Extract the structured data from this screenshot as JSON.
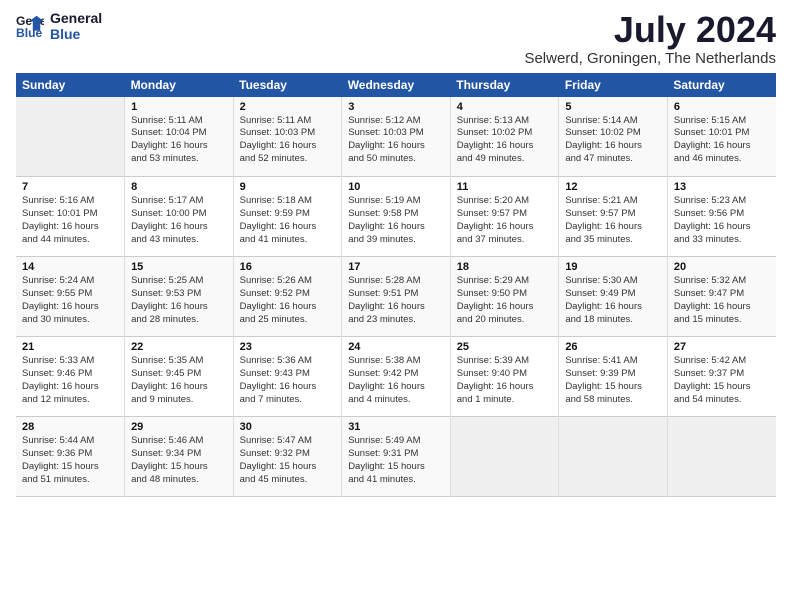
{
  "logo": {
    "line1": "General",
    "line2": "Blue"
  },
  "title": "July 2024",
  "location": "Selwerd, Groningen, The Netherlands",
  "weekdays": [
    "Sunday",
    "Monday",
    "Tuesday",
    "Wednesday",
    "Thursday",
    "Friday",
    "Saturday"
  ],
  "weeks": [
    [
      {
        "day": "",
        "info": ""
      },
      {
        "day": "1",
        "info": "Sunrise: 5:11 AM\nSunset: 10:04 PM\nDaylight: 16 hours\nand 53 minutes."
      },
      {
        "day": "2",
        "info": "Sunrise: 5:11 AM\nSunset: 10:03 PM\nDaylight: 16 hours\nand 52 minutes."
      },
      {
        "day": "3",
        "info": "Sunrise: 5:12 AM\nSunset: 10:03 PM\nDaylight: 16 hours\nand 50 minutes."
      },
      {
        "day": "4",
        "info": "Sunrise: 5:13 AM\nSunset: 10:02 PM\nDaylight: 16 hours\nand 49 minutes."
      },
      {
        "day": "5",
        "info": "Sunrise: 5:14 AM\nSunset: 10:02 PM\nDaylight: 16 hours\nand 47 minutes."
      },
      {
        "day": "6",
        "info": "Sunrise: 5:15 AM\nSunset: 10:01 PM\nDaylight: 16 hours\nand 46 minutes."
      }
    ],
    [
      {
        "day": "7",
        "info": "Sunrise: 5:16 AM\nSunset: 10:01 PM\nDaylight: 16 hours\nand 44 minutes."
      },
      {
        "day": "8",
        "info": "Sunrise: 5:17 AM\nSunset: 10:00 PM\nDaylight: 16 hours\nand 43 minutes."
      },
      {
        "day": "9",
        "info": "Sunrise: 5:18 AM\nSunset: 9:59 PM\nDaylight: 16 hours\nand 41 minutes."
      },
      {
        "day": "10",
        "info": "Sunrise: 5:19 AM\nSunset: 9:58 PM\nDaylight: 16 hours\nand 39 minutes."
      },
      {
        "day": "11",
        "info": "Sunrise: 5:20 AM\nSunset: 9:57 PM\nDaylight: 16 hours\nand 37 minutes."
      },
      {
        "day": "12",
        "info": "Sunrise: 5:21 AM\nSunset: 9:57 PM\nDaylight: 16 hours\nand 35 minutes."
      },
      {
        "day": "13",
        "info": "Sunrise: 5:23 AM\nSunset: 9:56 PM\nDaylight: 16 hours\nand 33 minutes."
      }
    ],
    [
      {
        "day": "14",
        "info": "Sunrise: 5:24 AM\nSunset: 9:55 PM\nDaylight: 16 hours\nand 30 minutes."
      },
      {
        "day": "15",
        "info": "Sunrise: 5:25 AM\nSunset: 9:53 PM\nDaylight: 16 hours\nand 28 minutes."
      },
      {
        "day": "16",
        "info": "Sunrise: 5:26 AM\nSunset: 9:52 PM\nDaylight: 16 hours\nand 25 minutes."
      },
      {
        "day": "17",
        "info": "Sunrise: 5:28 AM\nSunset: 9:51 PM\nDaylight: 16 hours\nand 23 minutes."
      },
      {
        "day": "18",
        "info": "Sunrise: 5:29 AM\nSunset: 9:50 PM\nDaylight: 16 hours\nand 20 minutes."
      },
      {
        "day": "19",
        "info": "Sunrise: 5:30 AM\nSunset: 9:49 PM\nDaylight: 16 hours\nand 18 minutes."
      },
      {
        "day": "20",
        "info": "Sunrise: 5:32 AM\nSunset: 9:47 PM\nDaylight: 16 hours\nand 15 minutes."
      }
    ],
    [
      {
        "day": "21",
        "info": "Sunrise: 5:33 AM\nSunset: 9:46 PM\nDaylight: 16 hours\nand 12 minutes."
      },
      {
        "day": "22",
        "info": "Sunrise: 5:35 AM\nSunset: 9:45 PM\nDaylight: 16 hours\nand 9 minutes."
      },
      {
        "day": "23",
        "info": "Sunrise: 5:36 AM\nSunset: 9:43 PM\nDaylight: 16 hours\nand 7 minutes."
      },
      {
        "day": "24",
        "info": "Sunrise: 5:38 AM\nSunset: 9:42 PM\nDaylight: 16 hours\nand 4 minutes."
      },
      {
        "day": "25",
        "info": "Sunrise: 5:39 AM\nSunset: 9:40 PM\nDaylight: 16 hours\nand 1 minute."
      },
      {
        "day": "26",
        "info": "Sunrise: 5:41 AM\nSunset: 9:39 PM\nDaylight: 15 hours\nand 58 minutes."
      },
      {
        "day": "27",
        "info": "Sunrise: 5:42 AM\nSunset: 9:37 PM\nDaylight: 15 hours\nand 54 minutes."
      }
    ],
    [
      {
        "day": "28",
        "info": "Sunrise: 5:44 AM\nSunset: 9:36 PM\nDaylight: 15 hours\nand 51 minutes."
      },
      {
        "day": "29",
        "info": "Sunrise: 5:46 AM\nSunset: 9:34 PM\nDaylight: 15 hours\nand 48 minutes."
      },
      {
        "day": "30",
        "info": "Sunrise: 5:47 AM\nSunset: 9:32 PM\nDaylight: 15 hours\nand 45 minutes."
      },
      {
        "day": "31",
        "info": "Sunrise: 5:49 AM\nSunset: 9:31 PM\nDaylight: 15 hours\nand 41 minutes."
      },
      {
        "day": "",
        "info": ""
      },
      {
        "day": "",
        "info": ""
      },
      {
        "day": "",
        "info": ""
      }
    ]
  ]
}
